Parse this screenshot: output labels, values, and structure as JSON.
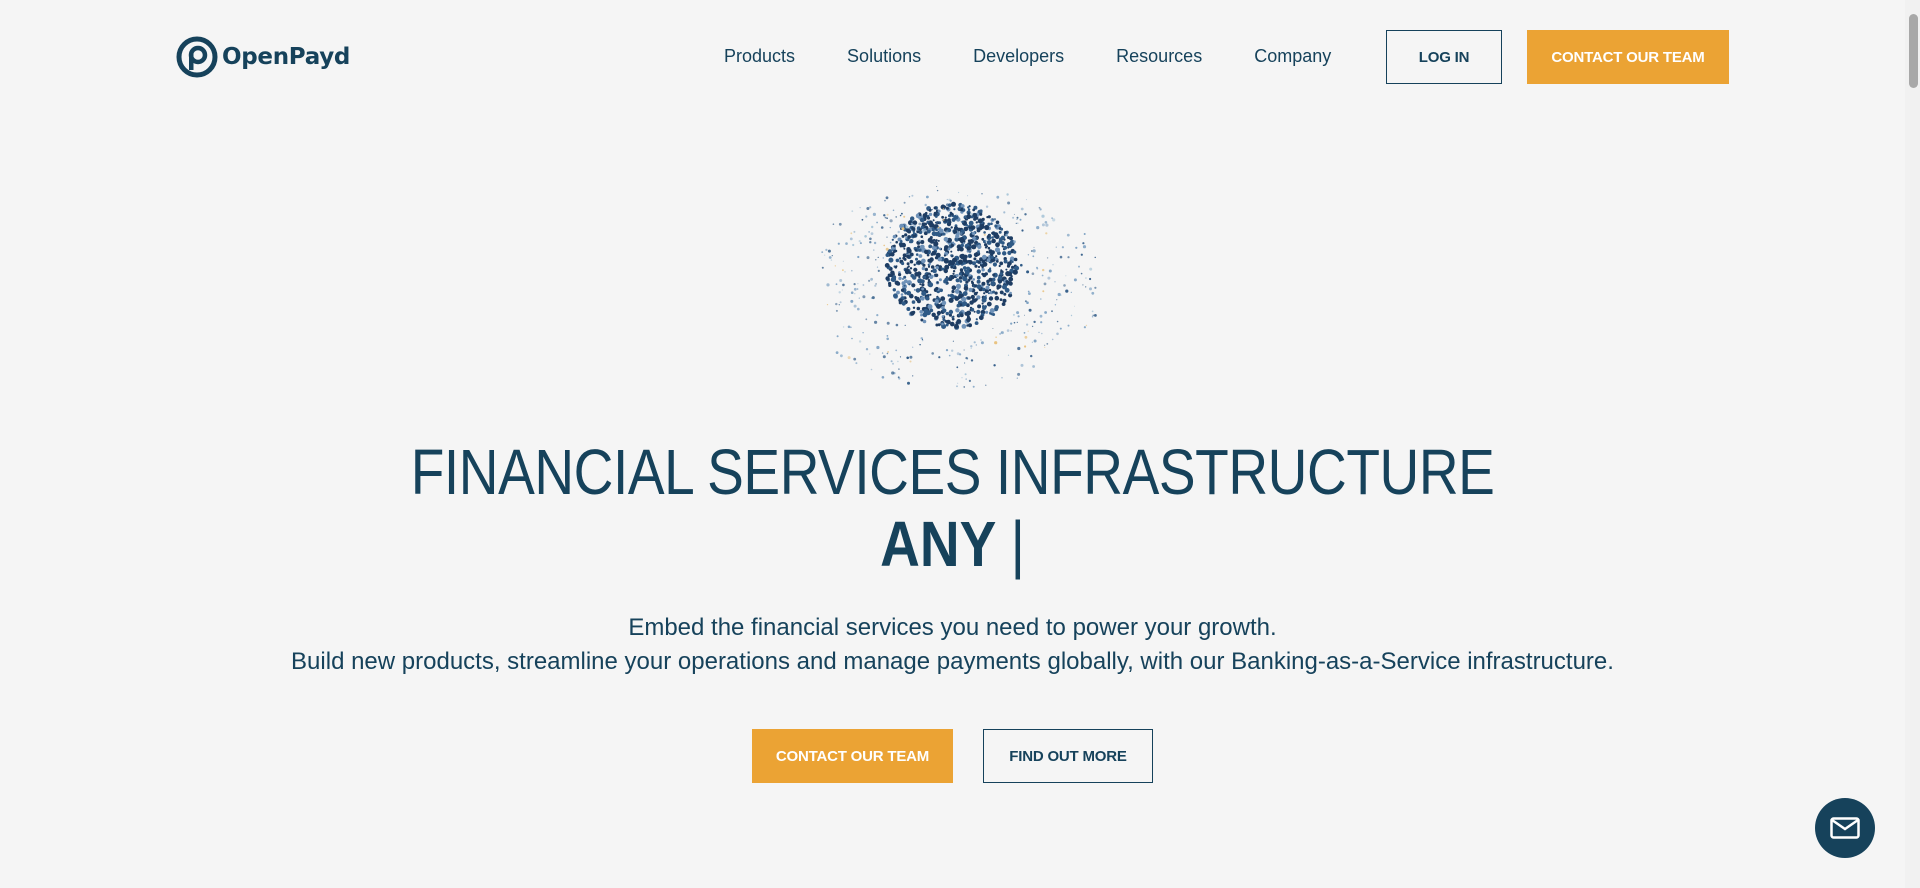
{
  "brand": {
    "name": "OpenPayd",
    "primary_color": "#16425b",
    "accent_color": "#eba334"
  },
  "nav": {
    "items": [
      "Products",
      "Solutions",
      "Developers",
      "Resources",
      "Company"
    ],
    "login_label": "LOG IN",
    "contact_label": "CONTACT OUR TEAM"
  },
  "hero": {
    "headline_line1": "FINANCIAL SERVICES INFRASTRUCTURE",
    "headline_line2": "ANY",
    "cursor": "|",
    "subtitle_line1": "Embed the financial services you need to power your growth.",
    "subtitle_line2": "Build new products, streamline your operations and manage payments globally, with our Banking-as-a-Service infrastructure.",
    "primary_cta": "CONTACT OUR TEAM",
    "secondary_cta": "FIND OUT MORE"
  },
  "chat": {
    "icon": "mail-icon"
  }
}
